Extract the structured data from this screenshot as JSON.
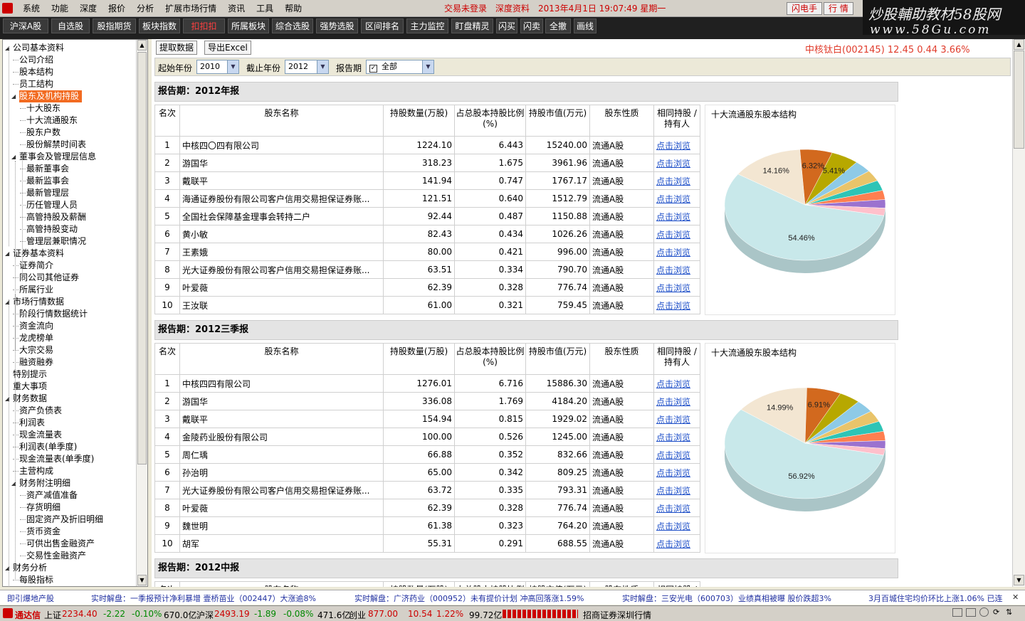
{
  "menubar": {
    "items": [
      "系统",
      "功能",
      "深度",
      "报价",
      "分析",
      "扩展市场行情",
      "资讯",
      "工具",
      "帮助"
    ],
    "status_login": "交易未登录",
    "status_info": "深度资料",
    "datetime": "2013年4月1日 19:07:49 星期一",
    "btn_flash": "闪电手",
    "btn_quote": "行  情"
  },
  "brand": {
    "line1": "炒股輔助教材58股网",
    "line2": "www.58Gu.com"
  },
  "toolbar": {
    "buttons": [
      "沪深A股",
      "自选股",
      "股指期货",
      "板块指数",
      "扣扣扣",
      "所属板块",
      "综合选股",
      "强势选股",
      "区间排名",
      "主力监控",
      "盯盘精灵",
      "闪买",
      "闪卖",
      "全撤",
      "画线"
    ]
  },
  "tree": {
    "nodes": [
      {
        "label": "公司基本资料",
        "expanded": true
      },
      {
        "label": "公司介绍"
      },
      {
        "label": "股本结构"
      },
      {
        "label": "员工结构"
      },
      {
        "label": "股东及机构持股",
        "expanded": true,
        "selected": true
      },
      {
        "label": "十大股东"
      },
      {
        "label": "十大流通股东"
      },
      {
        "label": "股东户数"
      },
      {
        "label": "股份解禁时间表"
      },
      {
        "label": "董事会及管理层信息",
        "expanded": true
      },
      {
        "label": "最新董事会"
      },
      {
        "label": "最新监事会"
      },
      {
        "label": "最新管理层"
      },
      {
        "label": "历任管理人员"
      },
      {
        "label": "高管持股及薪酬"
      },
      {
        "label": "高管持股变动"
      },
      {
        "label": "管理层兼职情况"
      },
      {
        "label": "证券基本资料",
        "expanded": true
      },
      {
        "label": "证券简介"
      },
      {
        "label": "同公司其他证券"
      },
      {
        "label": "所属行业"
      },
      {
        "label": "市场行情数据",
        "expanded": true
      },
      {
        "label": "阶段行情数据统计"
      },
      {
        "label": "资金流向"
      },
      {
        "label": "龙虎榜单"
      },
      {
        "label": "大宗交易"
      },
      {
        "label": "融资融券"
      },
      {
        "label": "特别提示"
      },
      {
        "label": "重大事项"
      },
      {
        "label": "财务数据",
        "expanded": true
      },
      {
        "label": "资产负债表"
      },
      {
        "label": "利润表"
      },
      {
        "label": "现金流量表"
      },
      {
        "label": "利润表(单季度)"
      },
      {
        "label": "现金流量表(单季度)"
      },
      {
        "label": "主营构成"
      },
      {
        "label": "财务附注明细",
        "expanded": true
      },
      {
        "label": "资产减值准备"
      },
      {
        "label": "存货明细"
      },
      {
        "label": "固定资产及折旧明细"
      },
      {
        "label": "货币资金"
      },
      {
        "label": "可供出售金融资产"
      },
      {
        "label": "交易性金融资产"
      },
      {
        "label": "财务分析",
        "expanded": true
      },
      {
        "label": "每股指标"
      }
    ]
  },
  "actions": {
    "fetch": "提取数据",
    "export": "导出Excel"
  },
  "quote": "中核钛白(002145)  12.45 0.44 3.66%",
  "filters": {
    "start_label": "起始年份",
    "start_value": "2010",
    "end_label": "截止年份",
    "end_value": "2012",
    "period_label": "报告期",
    "period_value": "全部"
  },
  "columns": [
    "名次",
    "股东名称",
    "持股数量(万股)",
    "占总股本持股比例(%)",
    "持股市值(万元)",
    "股东性质",
    "相同持股 /持有人"
  ],
  "link_text": "点击浏览",
  "pie_title": "十大流通股东股本结构",
  "sections": [
    {
      "title": "报告期：2012年报",
      "rows": [
        [
          "1",
          "中核四〇四有限公司",
          "1224.10",
          "6.443",
          "15240.00",
          "流通A股"
        ],
        [
          "2",
          "游国华",
          "318.23",
          "1.675",
          "3961.96",
          "流通A股"
        ],
        [
          "3",
          "戴联平",
          "141.94",
          "0.747",
          "1767.17",
          "流通A股"
        ],
        [
          "4",
          "海通证券股份有限公司客户信用交易担保证券账...",
          "121.51",
          "0.640",
          "1512.79",
          "流通A股"
        ],
        [
          "5",
          "全国社会保障基金理事会转持二户",
          "92.44",
          "0.487",
          "1150.88",
          "流通A股"
        ],
        [
          "6",
          "黄小敏",
          "82.43",
          "0.434",
          "1026.26",
          "流通A股"
        ],
        [
          "7",
          "王素娥",
          "80.00",
          "0.421",
          "996.00",
          "流通A股"
        ],
        [
          "8",
          "光大证券股份有限公司客户信用交易担保证券账...",
          "63.51",
          "0.334",
          "790.70",
          "流通A股"
        ],
        [
          "9",
          "叶爱薇",
          "62.39",
          "0.328",
          "776.74",
          "流通A股"
        ],
        [
          "10",
          "王汝联",
          "61.00",
          "0.321",
          "759.45",
          "流通A股"
        ]
      ],
      "pie": {
        "labels": [
          "54.46%",
          "14.16%",
          "6.32%",
          "5.41%"
        ],
        "values": [
          54.46,
          14.16,
          6.32,
          5.41,
          3.4,
          3.1,
          2.9,
          2.6,
          2.4,
          2.1
        ]
      }
    },
    {
      "title": "报告期：2012三季报",
      "rows": [
        [
          "1",
          "中核四四有限公司",
          "1276.01",
          "6.716",
          "15886.30",
          "流通A股"
        ],
        [
          "2",
          "游国华",
          "336.08",
          "1.769",
          "4184.20",
          "流通A股"
        ],
        [
          "3",
          "戴联平",
          "154.94",
          "0.815",
          "1929.02",
          "流通A股"
        ],
        [
          "4",
          "金陵药业股份有限公司",
          "100.00",
          "0.526",
          "1245.00",
          "流通A股"
        ],
        [
          "5",
          "周仁瑀",
          "66.88",
          "0.352",
          "832.66",
          "流通A股"
        ],
        [
          "6",
          "孙治明",
          "65.00",
          "0.342",
          "809.25",
          "流通A股"
        ],
        [
          "7",
          "光大证券股份有限公司客户信用交易担保证券账...",
          "63.72",
          "0.335",
          "793.31",
          "流通A股"
        ],
        [
          "8",
          "叶爱薇",
          "62.39",
          "0.328",
          "776.74",
          "流通A股"
        ],
        [
          "9",
          "魏世明",
          "61.38",
          "0.323",
          "764.20",
          "流通A股"
        ],
        [
          "10",
          "胡军",
          "55.31",
          "0.291",
          "688.55",
          "流通A股"
        ]
      ],
      "pie": {
        "labels": [
          "56.92%",
          "14.99%",
          "6.91%"
        ],
        "values": [
          56.92,
          14.99,
          6.91,
          4.3,
          3.7,
          3.3,
          3.0,
          2.7,
          2.3,
          1.9
        ]
      }
    },
    {
      "title": "报告期：2012中报"
    }
  ],
  "pie_colors": [
    "#c8e8ea",
    "#f3e6d2",
    "#d2691e",
    "#b7a800",
    "#8ecae6",
    "#e9c46a",
    "#2ec4b6",
    "#ff7f50",
    "#9b72cf",
    "#ffc0cb"
  ],
  "ticker": [
    "即引爆地产股",
    "实时解盘：一季报预计净利暴增 壹桥苗业（002447）大涨逾8%",
    "实时解盘：广济药业（000952）未有提价计划 冲高回落涨1.59%",
    "实时解盘：三安光电（600703）业绩真相被曝 股价跌超3%",
    "3月百城住宅均价环比上涨1.06% 已连"
  ],
  "statusbar": {
    "app": "通达信",
    "sh_label": "上证",
    "sh_value": "2234.40",
    "sh_chg": "-2.22",
    "sh_pct": "-0.10%",
    "sh_amt": "670.0亿",
    "hs_label": "沪深",
    "hs_value": "2493.19",
    "hs_chg": "-1.89",
    "hs_pct": "-0.08%",
    "hs_amt": "471.6亿",
    "cy_label": "创业",
    "cy_value": "877.00",
    "cy_chg": "10.54",
    "cy_pct": "1.22%",
    "cy_amt": "99.72亿",
    "broker": "招商证券深圳行情"
  }
}
